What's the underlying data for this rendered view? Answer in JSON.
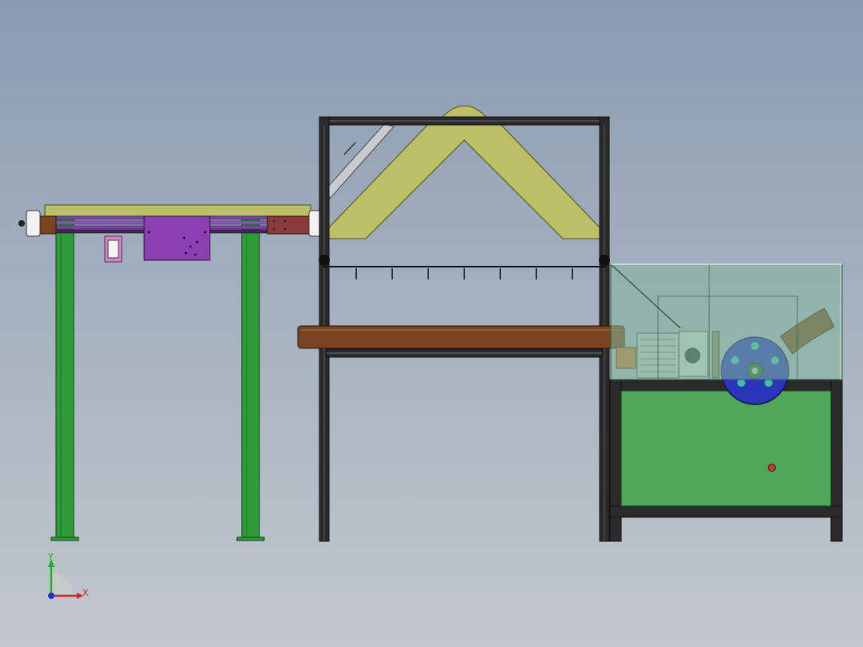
{
  "triad": {
    "y_label": "Y",
    "x_label": "X"
  },
  "colors": {
    "frame": "#1f1f1f",
    "leg_green": "#2e9c3a",
    "belt_tan": "#bcbf66",
    "roller_brown": "#7a4422",
    "motor_purple": "#8c3fb3",
    "base_green": "#4fa85a",
    "flywheel_blue": "#2a35b8",
    "hood_glass": "#7fb79a",
    "indicator_red": "#c43a3a",
    "axis_x": "#e02020",
    "axis_y": "#20b020",
    "axis_z": "#2030d0"
  }
}
